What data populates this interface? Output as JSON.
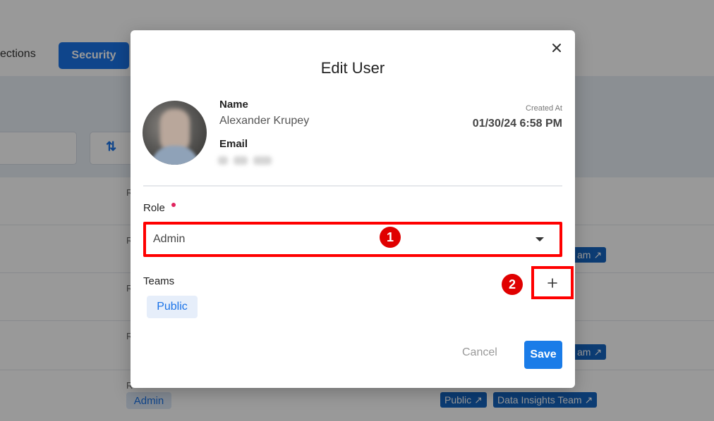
{
  "background": {
    "tabs": [
      {
        "label": "ections"
      },
      {
        "label": "Security"
      }
    ],
    "role_label": "R",
    "row_role_chip": "Admin",
    "team_chips": [
      {
        "label": "Public"
      },
      {
        "label": "Data Insights Team"
      },
      {
        "label": "am"
      },
      {
        "label": "am"
      }
    ],
    "accent_color": "#1a73e8"
  },
  "modal": {
    "title": "Edit User",
    "user": {
      "name_label": "Name",
      "name": "Alexander Krupey",
      "email_label": "Email",
      "created_label": "Created At",
      "created_value": "01/30/24 6:58 PM"
    },
    "role": {
      "label": "Role",
      "required": true,
      "value": "Admin"
    },
    "teams": {
      "label": "Teams",
      "items": [
        {
          "label": "Public"
        }
      ]
    },
    "buttons": {
      "cancel": "Cancel",
      "save": "Save"
    }
  },
  "annotations": [
    {
      "number": "1"
    },
    {
      "number": "2"
    }
  ],
  "colors": {
    "highlight": "#ff0000",
    "save_button": "#1a7ce8",
    "required_dot": "#e0245e"
  },
  "icons": [
    "close-icon",
    "chevron-down-icon",
    "plus-icon",
    "sort-alpha-icon",
    "external-link-icon"
  ]
}
